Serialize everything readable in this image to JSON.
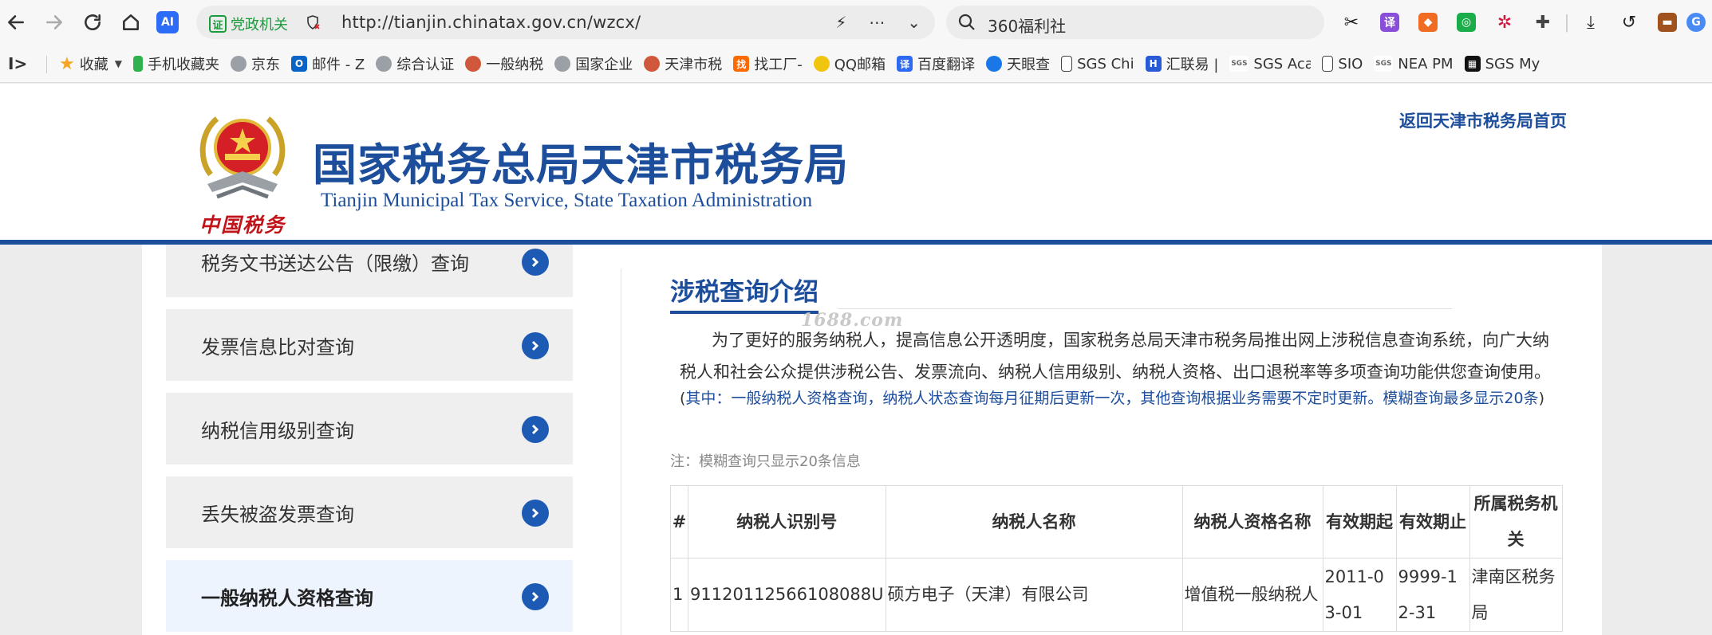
{
  "browser": {
    "url": "http://tianjin.chinatax.gov.cn/wzcx/",
    "cert_label": "党政机关",
    "ai_label": "AI",
    "search_text": "360福利社",
    "translate_glyph": "译"
  },
  "bookmarks": [
    {
      "label": "收藏",
      "icon": "star-icon"
    },
    {
      "label": "手机收藏夹",
      "icon": "phone-icon"
    },
    {
      "label": "京东",
      "icon": "globe-icon"
    },
    {
      "label": "邮件 - Z",
      "icon": "outlook-icon"
    },
    {
      "label": "综合认证",
      "icon": "globe-icon"
    },
    {
      "label": "一般纳税",
      "icon": "tax-emblem-icon"
    },
    {
      "label": "国家企业",
      "icon": "globe-icon"
    },
    {
      "label": "天津市税",
      "icon": "tax-emblem-icon"
    },
    {
      "label": "找工厂-",
      "icon": "factory-icon"
    },
    {
      "label": "QQ邮箱",
      "icon": "qq-mail-icon"
    },
    {
      "label": "百度翻译",
      "icon": "baidu-translate-icon"
    },
    {
      "label": "天眼查",
      "icon": "tianyancha-icon"
    },
    {
      "label": "SGS Chi",
      "icon": "document-icon"
    },
    {
      "label": "汇联易 |",
      "icon": "huilianyi-icon"
    },
    {
      "label": "SGS Aca",
      "icon": "sgs-icon"
    },
    {
      "label": "SIO",
      "icon": "document-icon"
    },
    {
      "label": "NEA PM",
      "icon": "sgs-icon"
    },
    {
      "label": "SGS My",
      "icon": "windows-icon"
    }
  ],
  "header": {
    "emblem_text": "中国税务",
    "title": "国家税务总局天津市税务局",
    "subtitle": "Tianjin Municipal Tax Service, State Taxation Administration",
    "home_link": "返回天津市税务局首页"
  },
  "sidebar": {
    "items": [
      {
        "label": "税务文书送达公告（限缴）查询",
        "active": false
      },
      {
        "label": "发票信息比对查询",
        "active": false
      },
      {
        "label": "纳税信用级别查询",
        "active": false
      },
      {
        "label": "丢失被盗发票查询",
        "active": false
      },
      {
        "label": "一般纳税人资格查询",
        "active": true
      }
    ]
  },
  "main": {
    "title": "涉税查询介绍",
    "watermark": "1688.com",
    "intro": "为了更好的服务纳税人，提高信息公开透明度，国家税务总局天津市税务局推出网上涉税信息查询系统，向广大纳税人和社会公众提供涉税公告、发票流向、纳税人信用级别、纳税人资格、出口退税率等多项查询功能供您查询使用。",
    "note_open": "(",
    "note": "其中：一般纳税人资格查询，纳税人状态查询每月征期后更新一次，其他查询根据业务需要不定时更新。模糊查询最多显示20条",
    "note_close": ")",
    "small_note": "注：模糊查询只显示20条信息"
  },
  "table": {
    "headers": [
      "#",
      "纳税人识别号",
      "纳税人名称",
      "纳税人资格名称",
      "有效期起",
      "有效期止",
      "所属税务机关"
    ],
    "rows": [
      [
        "1",
        "91120112566108088U",
        "硕方电子（天津）有限公司",
        "增值税一般纳税人",
        "2011-03-01",
        "9999-12-31",
        "津南区税务局"
      ]
    ]
  },
  "colors": {
    "brand_blue": "#1d4e9c",
    "arrow_blue": "#1d5ab4",
    "cert_green": "#1a9b3c",
    "emblem_red": "#c0141a"
  }
}
